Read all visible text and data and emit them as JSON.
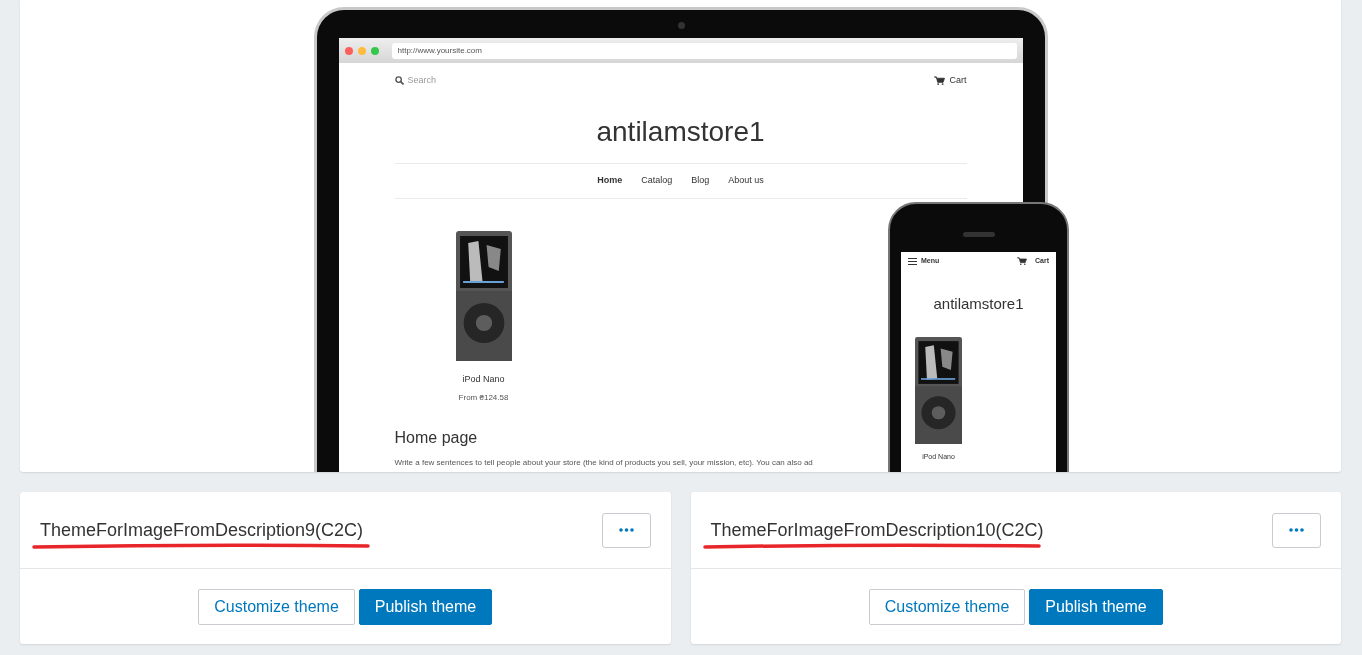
{
  "preview": {
    "browser": {
      "url": "http://www.yoursite.com"
    },
    "store": {
      "search_placeholder": "Search",
      "cart": "Cart",
      "title": "antilamstore1",
      "nav": [
        {
          "label": "Home",
          "selected": true
        },
        {
          "label": "Catalog",
          "selected": false
        },
        {
          "label": "Blog",
          "selected": false
        },
        {
          "label": "About us",
          "selected": false
        }
      ],
      "products": [
        {
          "name": "iPod Nano",
          "price": "From ₴124.58"
        }
      ],
      "heading": "Home page",
      "text": "Write a few sentences to tell people about your store (the kind of products you sell, your mission, etc). You can also ad"
    },
    "mobile": {
      "menu": "Menu",
      "cart": "Cart",
      "title": "antilamstore1",
      "products": [
        {
          "name": "iPod Nano"
        }
      ]
    }
  },
  "themes": [
    {
      "name": "ThemeForImageFromDescription9(C2C)",
      "underlined": true,
      "customize": "Customize theme",
      "publish": "Publish theme"
    },
    {
      "name": "ThemeForImageFromDescription10(C2C)",
      "underlined": true,
      "customize": "Customize theme",
      "publish": "Publish theme"
    }
  ]
}
